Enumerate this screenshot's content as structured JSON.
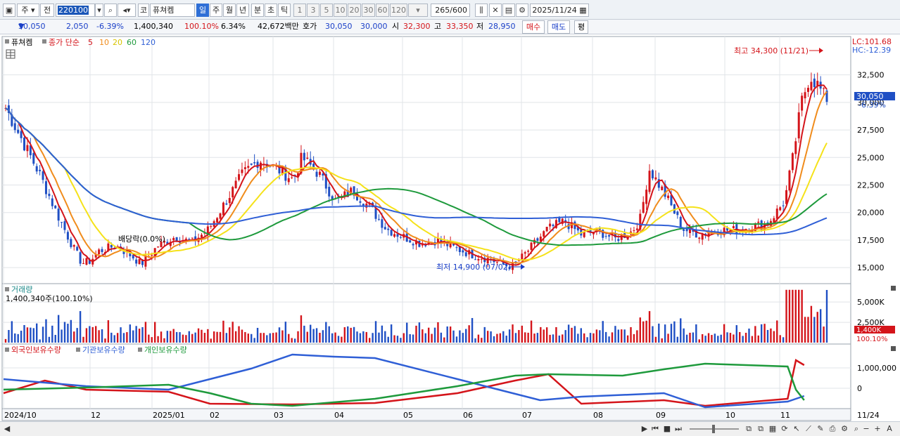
{
  "toolbar": {
    "period_main": "주",
    "prev_label": "전",
    "code": "220100",
    "market_label": "코",
    "stock_name": "퓨쳐켐",
    "periods": [
      "일",
      "주",
      "월",
      "년",
      "분",
      "초",
      "틱"
    ],
    "intervals": [
      "1",
      "3",
      "5",
      "10",
      "20",
      "30",
      "60",
      "120"
    ],
    "count": "265",
    "count_max": "/600",
    "date": "2025/11/24"
  },
  "quote": {
    "price": "30,050",
    "change": "2,050",
    "change_pct": "-6.39%",
    "volume": "1,400,340",
    "vol_ratio": "100.10%",
    "turnover": "6.34%",
    "amount": "42,672백만",
    "bid_label": "호가",
    "bid": "30,050",
    "ask": "30,000",
    "open_label": "시",
    "open": "32,300",
    "high_label": "고",
    "high": "33,350",
    "low_label": "저",
    "low": "28,950",
    "buy_label": "매수",
    "sell_label": "매도",
    "avg_label": "평"
  },
  "legend": {
    "name": "퓨쳐켐",
    "ma_title": "종가 단순",
    "ma": [
      "5",
      "10",
      "20",
      "60",
      "120"
    ],
    "ma_colors": [
      "#d4141a",
      "#f08c1c",
      "#f5e21a",
      "#1e9a3c",
      "#2f5fd6"
    ]
  },
  "price_panel": {
    "lc": "LC:101.68",
    "hc": "HC:-12.39",
    "ticks": [
      "32,500",
      "30,000",
      "27,500",
      "25,000",
      "22,500",
      "20,000",
      "17,500",
      "15,000"
    ],
    "tick_values": [
      32500,
      30000,
      27500,
      25000,
      22500,
      20000,
      17500,
      15000
    ],
    "current": "30,050",
    "current_pct": "-6.39%",
    "high_note": "최고 34,300 (11/21)",
    "low_note": "최저 14,900 (07/02)",
    "dividend_note": "배당락(0.0%)"
  },
  "volume_panel": {
    "title": "거래량",
    "value": "1,400,340주(100.10%)",
    "ticks": [
      "5,000K",
      "2,500K"
    ],
    "current": "1,400K",
    "current_pct": "100.10%"
  },
  "holdings_panel": {
    "series": [
      "외국인보유수량",
      "기관보유수량",
      "개인보유수량"
    ],
    "series_colors": [
      "#d4141a",
      "#2f5fd6",
      "#1e9a3c"
    ],
    "ticks": [
      "1,000,000",
      "0"
    ]
  },
  "x_axis": {
    "labels": [
      "2024/10",
      "12",
      "2025/01",
      "02",
      "03",
      "04",
      "05",
      "06",
      "07",
      "08",
      "09",
      "10",
      "11"
    ],
    "right_label": "11/24"
  },
  "chart_data": {
    "type": "line",
    "title": "퓨쳐켐",
    "ylim": [
      13800,
      35600
    ],
    "price_path": [
      [
        0.0,
        29500
      ],
      [
        0.02,
        26500
      ],
      [
        0.04,
        23500
      ],
      [
        0.06,
        20000
      ],
      [
        0.08,
        16800
      ],
      [
        0.09,
        15400
      ],
      [
        0.1,
        15600
      ],
      [
        0.11,
        16500
      ],
      [
        0.13,
        17000
      ],
      [
        0.15,
        16000
      ],
      [
        0.16,
        15300
      ],
      [
        0.18,
        17000
      ],
      [
        0.2,
        17800
      ],
      [
        0.22,
        17300
      ],
      [
        0.24,
        18500
      ],
      [
        0.26,
        21000
      ],
      [
        0.28,
        23500
      ],
      [
        0.3,
        24800
      ],
      [
        0.32,
        24000
      ],
      [
        0.34,
        23000
      ],
      [
        0.35,
        25000
      ],
      [
        0.37,
        23500
      ],
      [
        0.39,
        21000
      ],
      [
        0.41,
        22000
      ],
      [
        0.43,
        20500
      ],
      [
        0.45,
        18500
      ],
      [
        0.47,
        17800
      ],
      [
        0.49,
        17200
      ],
      [
        0.51,
        17500
      ],
      [
        0.53,
        16800
      ],
      [
        0.55,
        16200
      ],
      [
        0.57,
        15800
      ],
      [
        0.59,
        15200
      ],
      [
        0.6,
        15100
      ],
      [
        0.62,
        16800
      ],
      [
        0.64,
        18500
      ],
      [
        0.66,
        19200
      ],
      [
        0.68,
        18000
      ],
      [
        0.7,
        18300
      ],
      [
        0.72,
        17600
      ],
      [
        0.74,
        18300
      ],
      [
        0.75,
        19500
      ],
      [
        0.76,
        24000
      ],
      [
        0.78,
        21500
      ],
      [
        0.8,
        18500
      ],
      [
        0.82,
        18000
      ],
      [
        0.84,
        18400
      ],
      [
        0.86,
        18400
      ],
      [
        0.88,
        18700
      ],
      [
        0.9,
        19000
      ],
      [
        0.92,
        21000
      ],
      [
        0.93,
        25000
      ],
      [
        0.94,
        30000
      ],
      [
        0.95,
        32500
      ],
      [
        0.96,
        31500
      ],
      [
        0.97,
        30050
      ]
    ]
  }
}
